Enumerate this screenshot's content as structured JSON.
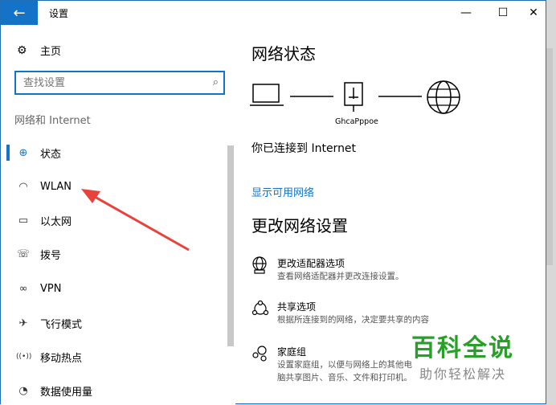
{
  "window": {
    "title": "设置",
    "back_icon": "←",
    "minimize_icon": "—",
    "maximize_icon": "☐",
    "close_icon": "✕"
  },
  "sidebar": {
    "home_label": "主页",
    "search_placeholder": "查找设置",
    "section_label": "网络和 Internet",
    "items": [
      {
        "label": "状态",
        "icon": "status-globe-icon",
        "glyph": "⊕",
        "active": true
      },
      {
        "label": "WLAN",
        "icon": "wifi-icon",
        "glyph": "◠",
        "active": false
      },
      {
        "label": "以太网",
        "icon": "ethernet-icon",
        "glyph": "▭",
        "active": false
      },
      {
        "label": "拨号",
        "icon": "dialup-icon",
        "glyph": "☏",
        "active": false
      },
      {
        "label": "VPN",
        "icon": "vpn-icon",
        "glyph": "∞",
        "active": false
      },
      {
        "label": "飞行模式",
        "icon": "airplane-icon",
        "glyph": "✈",
        "active": false
      },
      {
        "label": "移动热点",
        "icon": "hotspot-icon",
        "glyph": "((•))",
        "active": false
      },
      {
        "label": "数据使用量",
        "icon": "data-usage-icon",
        "glyph": "◔",
        "active": false
      }
    ]
  },
  "main": {
    "title": "网络状态",
    "network_node_label": "GhcaPppoe",
    "connected_text": "你已连接到 Internet",
    "show_networks_link": "显示可用网络",
    "change_settings_title": "更改网络设置",
    "settings": [
      {
        "title": "更改适配器选项",
        "desc": "查看网络适配器并更改连接设置。",
        "icon": "adapter-icon"
      },
      {
        "title": "共享选项",
        "desc": "根据所连接到的网络，决定要共享的内容",
        "icon": "sharing-icon"
      },
      {
        "title": "家庭组",
        "desc": "设置家庭组，以便与网络上的其他电脑共享图片、音乐、文件和打印机。",
        "icon": "homegroup-icon"
      }
    ]
  },
  "watermark": {
    "logo": "百科全说",
    "sub": "助你轻松解决"
  },
  "colors": {
    "accent": "#1473c9",
    "watermark_green": "#27a027"
  }
}
